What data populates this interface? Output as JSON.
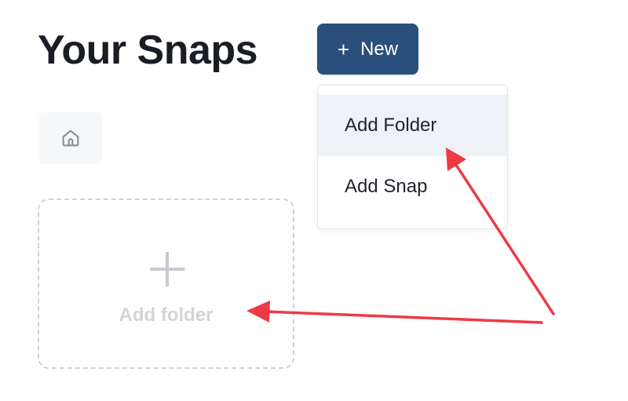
{
  "header": {
    "title": "Your Snaps"
  },
  "new_button": {
    "label": "New",
    "icon": "plus-icon",
    "color": "#2a4f7c"
  },
  "dropdown": {
    "items": [
      {
        "label": "Add Folder",
        "highlighted": true
      },
      {
        "label": "Add Snap",
        "highlighted": false
      }
    ]
  },
  "breadcrumb": {
    "home_icon": "home-icon"
  },
  "add_folder_card": {
    "label": "Add folder",
    "icon": "plus-icon"
  },
  "annotations": {
    "arrow_color": "#ee3a45"
  }
}
